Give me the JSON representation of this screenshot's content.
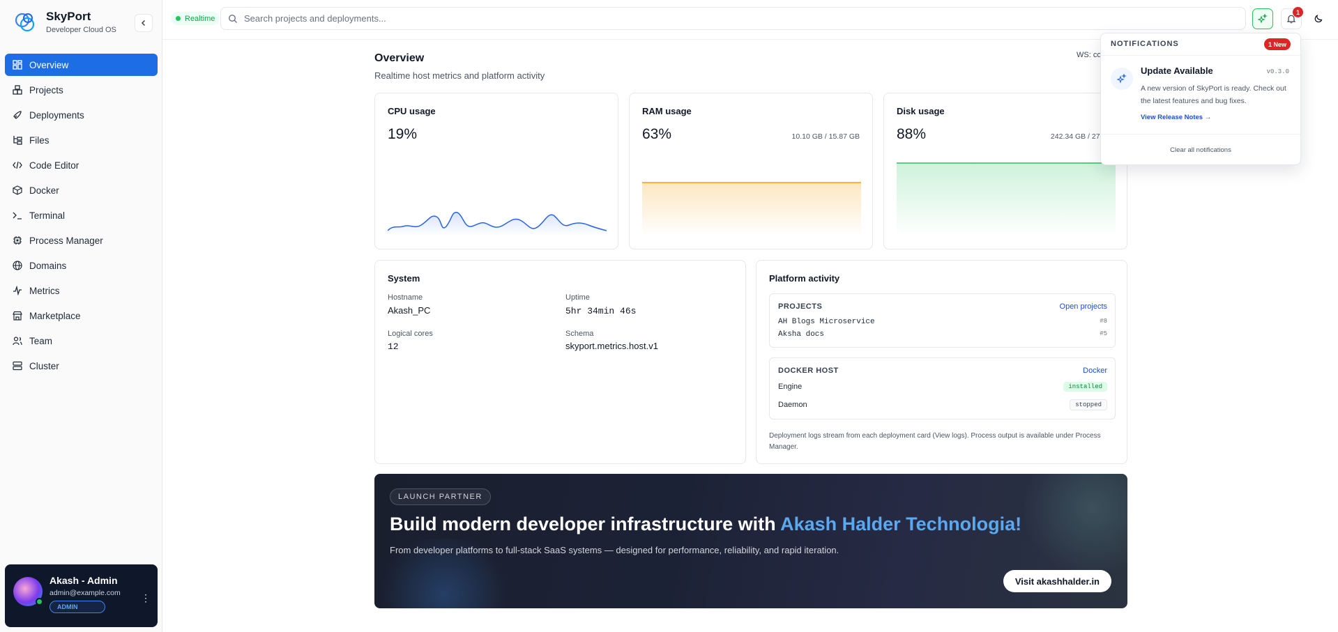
{
  "brand": {
    "name": "SkyPort",
    "subtitle": "Developer Cloud OS"
  },
  "sidebar": {
    "items": [
      {
        "label": "Overview",
        "icon": "grid-icon",
        "active": true
      },
      {
        "label": "Projects",
        "icon": "boxes-icon"
      },
      {
        "label": "Deployments",
        "icon": "rocket-icon"
      },
      {
        "label": "Files",
        "icon": "folder-tree-icon"
      },
      {
        "label": "Code Editor",
        "icon": "code-icon"
      },
      {
        "label": "Docker",
        "icon": "container-icon"
      },
      {
        "label": "Terminal",
        "icon": "terminal-icon"
      },
      {
        "label": "Process Manager",
        "icon": "cpu-icon"
      },
      {
        "label": "Domains",
        "icon": "globe-icon"
      },
      {
        "label": "Metrics",
        "icon": "activity-icon"
      },
      {
        "label": "Marketplace",
        "icon": "store-icon"
      },
      {
        "label": "Team",
        "icon": "users-icon"
      },
      {
        "label": "Cluster",
        "icon": "server-icon"
      }
    ]
  },
  "user": {
    "name": "Akash - Admin",
    "email": "admin@example.com",
    "role": "ADMIN"
  },
  "topbar": {
    "status": "Realtime",
    "search_placeholder": "Search projects and deployments...",
    "notification_count": "1"
  },
  "main": {
    "title": "Overview",
    "subtitle": "Realtime host metrics and platform activity",
    "ws_status": "WS: co"
  },
  "metrics": {
    "cpu": {
      "title": "CPU usage",
      "percent": "19%",
      "line_color": "#2563eb"
    },
    "ram": {
      "title": "RAM usage",
      "percent": "63%",
      "detail": "10.10 GB / 15.87 GB",
      "line_color": "#f59e0b"
    },
    "disk": {
      "title": "Disk usage",
      "percent": "88%",
      "detail": "242.34 GB / 275.49",
      "line_color": "#22c55e"
    }
  },
  "system": {
    "title": "System",
    "hostname_label": "Hostname",
    "hostname": "Akash_PC",
    "uptime_label": "Uptime",
    "uptime": "5hr 34min 46s",
    "cores_label": "Logical cores",
    "cores": "12",
    "schema_label": "Schema",
    "schema": "skyport.metrics.host.v1"
  },
  "activity": {
    "title": "Platform activity",
    "projects_head": "PROJECTS",
    "projects_link": "Open projects",
    "projects": [
      {
        "name": "AH Blogs Microservice",
        "num": "#8"
      },
      {
        "name": "Aksha docs",
        "num": "#5"
      }
    ],
    "docker_head": "DOCKER HOST",
    "docker_link": "Docker",
    "engine_label": "Engine",
    "engine_status": "installed",
    "daemon_label": "Daemon",
    "daemon_status": "stopped",
    "note": "Deployment logs stream from each deployment card (View logs). Process output is available under Process Manager."
  },
  "banner": {
    "tag": "LAUNCH PARTNER",
    "headline": "Build modern developer infrastructure with ",
    "headline_accent": "Akash Halder Technologia!",
    "subtitle": "From developer platforms to full-stack SaaS systems — designed for performance, reliability, and rapid iteration.",
    "button": "Visit akashhalder.in"
  },
  "notifications": {
    "title": "NOTIFICATIONS",
    "new_badge": "1 New",
    "item_title": "Update Available",
    "item_version": "v0.3.0",
    "item_body": "A new version of SkyPort is ready. Check out the latest features and bug fixes.",
    "item_link": "View Release Notes →",
    "clear": "Clear all notifications"
  }
}
